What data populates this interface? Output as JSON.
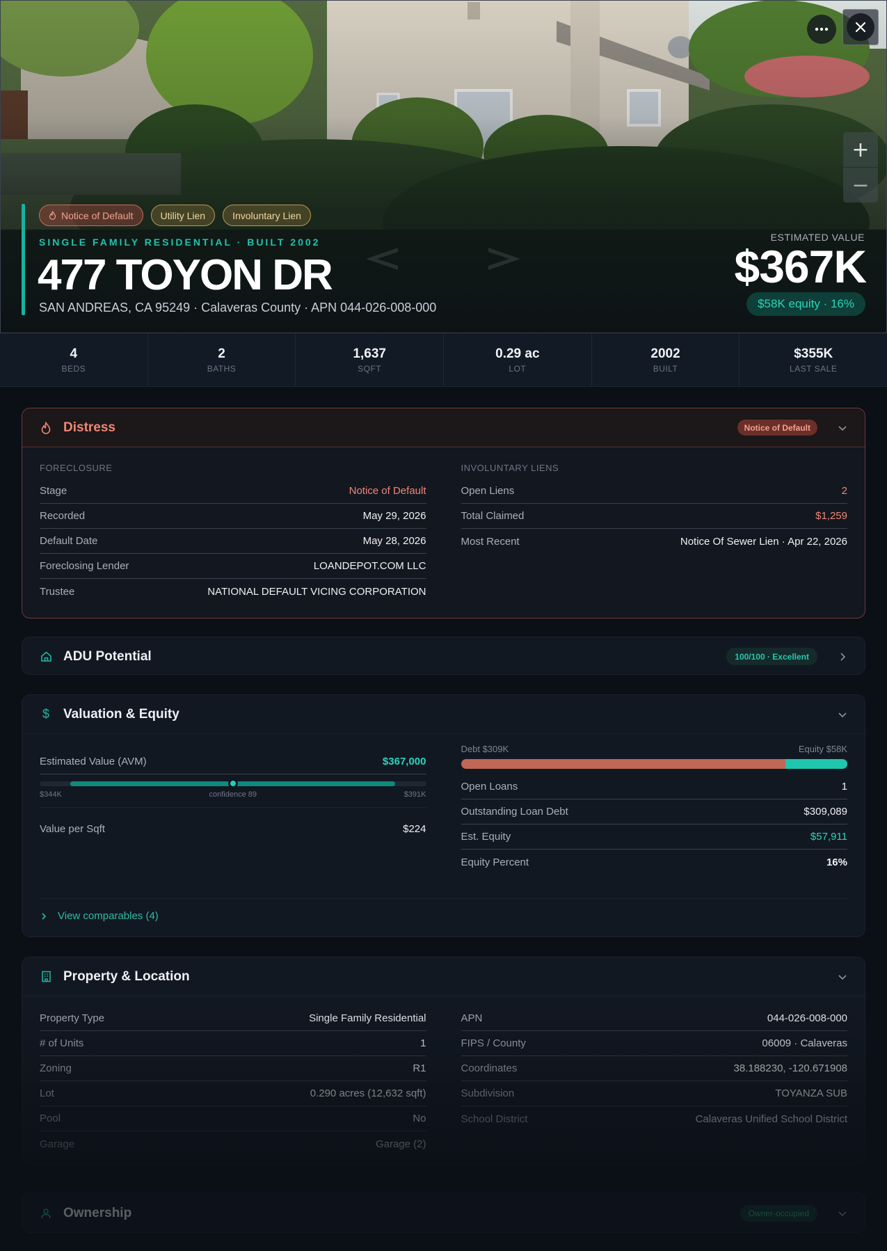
{
  "hero": {
    "tags": [
      "Notice of Default",
      "Utility Lien",
      "Involuntary Lien"
    ],
    "property_type_line": "SINGLE FAMILY RESIDENTIAL · BUILT 2002",
    "address": "477 TOYON DR",
    "sub_address": "SAN ANDREAS, CA 95249 · Calaveras County · APN 044-026-008-000",
    "estimated_value_label": "ESTIMATED VALUE",
    "estimated_value": "$367K",
    "equity_pill": "$58K equity · 16%",
    "icons": [
      "more-icon",
      "close-icon",
      "zoom-in-icon",
      "zoom-out-icon",
      "chevron-left-icon",
      "chevron-right-icon",
      "flame-icon"
    ]
  },
  "stats": [
    {
      "value": "4",
      "label": "BEDS"
    },
    {
      "value": "2",
      "label": "BATHS"
    },
    {
      "value": "1,637",
      "label": "SQFT"
    },
    {
      "value": "0.29 ac",
      "label": "LOT"
    },
    {
      "value": "2002",
      "label": "BUILT"
    },
    {
      "value": "$355K",
      "label": "LAST SALE"
    }
  ],
  "distress": {
    "title": "Distress",
    "badge": "Notice of Default",
    "foreclosure": {
      "label": "FORECLOSURE",
      "rows": [
        {
          "k": "Stage",
          "v": "Notice of Default"
        },
        {
          "k": "Recorded",
          "v": "May 29, 2026"
        },
        {
          "k": "Default Date",
          "v": "May 28, 2026"
        },
        {
          "k": "Foreclosing Lender",
          "v": "LOANDEPOT.COM LLC"
        },
        {
          "k": "Trustee",
          "v": "NATIONAL DEFAULT VICING CORPORATION"
        }
      ]
    },
    "liens": {
      "label": "INVOLUNTARY LIENS",
      "rows": [
        {
          "k": "Open Liens",
          "v": "2"
        },
        {
          "k": "Total Claimed",
          "v": "$1,259"
        },
        {
          "k": "Most Recent",
          "v": "Notice Of Sewer Lien · Apr 22, 2026"
        }
      ]
    }
  },
  "adu": {
    "title": "ADU Potential",
    "badge": "100/100 · Excellent"
  },
  "valuation": {
    "title": "Valuation & Equity",
    "avm_label": "Estimated Value (AVM)",
    "avm_value": "$367,000",
    "range_low": "$344K",
    "range_high": "$391K",
    "confidence": "confidence 89",
    "range_low_fraction": 0.08,
    "range_high_fraction": 0.92,
    "point_fraction": 0.5,
    "value_per_sqft_label": "Value per Sqft",
    "value_per_sqft": "$224",
    "debt_label": "Debt $309K",
    "equity_label": "Equity $58K",
    "debt_fraction": 0.84,
    "rows": [
      {
        "k": "Open Loans",
        "v": "1"
      },
      {
        "k": "Outstanding Loan Debt",
        "v": "$309,089"
      },
      {
        "k": "Est. Equity",
        "v": "$57,911"
      },
      {
        "k": "Equity Percent",
        "v": "16%"
      }
    ],
    "comparables_link": "View comparables (4)"
  },
  "property": {
    "title": "Property & Location",
    "left_rows": [
      {
        "k": "Property Type",
        "v": "Single Family Residential"
      },
      {
        "k": "# of Units",
        "v": "1"
      },
      {
        "k": "Zoning",
        "v": "R1"
      },
      {
        "k": "Lot",
        "v": "0.290 acres (12,632 sqft)"
      },
      {
        "k": "Pool",
        "v": "No"
      },
      {
        "k": "Garage",
        "v": "Garage (2)"
      }
    ],
    "right_rows": [
      {
        "k": "APN",
        "v": "044-026-008-000"
      },
      {
        "k": "FIPS / County",
        "v": "06009 · Calaveras"
      },
      {
        "k": "Coordinates",
        "v": "38.188230, -120.671908"
      },
      {
        "k": "Subdivision",
        "v": "TOYANZA SUB"
      },
      {
        "k": "School District",
        "v": "Calaveras Unified School District"
      }
    ]
  },
  "ownership": {
    "title": "Ownership",
    "badge": "Owner-occupied"
  },
  "colors": {
    "accent": "#17b3a1",
    "danger": "#f08773",
    "debt": "#c16755",
    "equity": "#1ec6ad",
    "background": "#0b0f16"
  }
}
